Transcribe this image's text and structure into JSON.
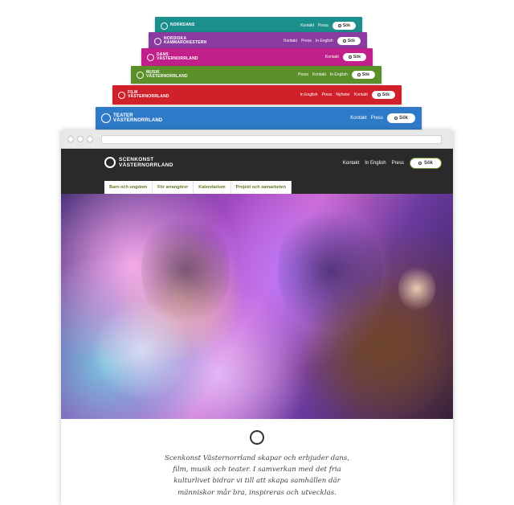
{
  "stack": [
    {
      "title": "NORRDANS",
      "color": "#1a8f8c",
      "links": [
        "Kontakt",
        "Press"
      ],
      "sok": "Sök"
    },
    {
      "title": "NORDISKA KAMMAROKESTERN",
      "color": "#8a3aa0",
      "links": [
        "Kontakt",
        "Press",
        "In English"
      ],
      "sok": "Sök"
    },
    {
      "title": "DANS VÄSTERNORRLAND",
      "color": "#c1208a",
      "links": [
        "Kontakt"
      ],
      "sok": "Sök"
    },
    {
      "title": "MUSIK VÄSTERNORRLAND",
      "color": "#5a8f2a",
      "links": [
        "Press",
        "Kontakt",
        "In English"
      ],
      "sok": "Sök"
    },
    {
      "title": "FILM VÄSTERNORRLAND",
      "color": "#d0202a",
      "links": [
        "In English",
        "Press",
        "Nyheter",
        "Kontakt"
      ],
      "sok": "Sök"
    },
    {
      "title": "TEATER VÄSTERNORRLAND",
      "color": "#2f7ac8",
      "links": [
        "Kontakt",
        "Press"
      ],
      "sok": "Sök"
    }
  ],
  "site": {
    "logo_line1": "SCENKONST",
    "logo_line2": "VÄSTERNORRLAND",
    "top_links": [
      "Kontakt",
      "In English",
      "Press"
    ],
    "sok": "Sök",
    "tabs": [
      "Barn och ungdom",
      "För arrangörer",
      "Kalendarium",
      "Projekt och samarbeten"
    ],
    "intro": "Scenkonst Västernorrland skapar och erbjuder dans, film, musik och teater. I samverkan med det fria kulturlivet bidrar vi till att skapa samhällen där människor mår bra, inspireras och utvecklas."
  }
}
